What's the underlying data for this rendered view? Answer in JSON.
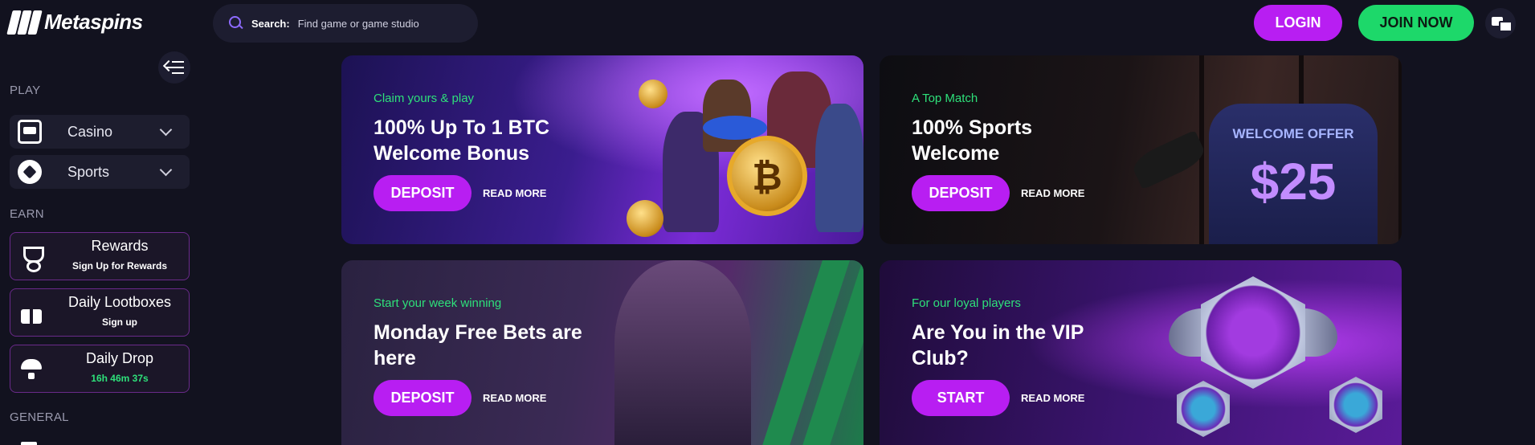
{
  "header": {
    "logo_text": "Metaspins",
    "search": {
      "label": "Search:",
      "placeholder": "Find game or game studio"
    },
    "login_label": "LOGIN",
    "join_label": "JOIN NOW"
  },
  "sidebar": {
    "play_title": "PLAY",
    "play_items": [
      {
        "label": "Casino",
        "icon": "slot-machine-icon"
      },
      {
        "label": "Sports",
        "icon": "soccer-ball-icon"
      }
    ],
    "earn_title": "EARN",
    "earn_items": [
      {
        "title": "Rewards",
        "subtitle": "Sign Up for Rewards",
        "icon": "trophy-icon"
      },
      {
        "title": "Daily Lootboxes",
        "subtitle": "Sign up",
        "icon": "gift-icon"
      },
      {
        "title": "Daily Drop",
        "subtitle": "16h 46m 37s",
        "icon": "parachute-icon"
      }
    ],
    "general_title": "GENERAL"
  },
  "promos": [
    {
      "tag": "Claim yours & play",
      "title": "100% Up To 1 BTC Welcome Bonus",
      "button": "DEPOSIT",
      "link": "READ MORE"
    },
    {
      "tag": "A Top Match",
      "title": "100% Sports Welcome",
      "button": "DEPOSIT",
      "link": "READ MORE",
      "art_text_1": "WELCOME OFFER",
      "art_text_2": "$25"
    },
    {
      "tag": "Start your week winning",
      "title": "Monday Free Bets are here",
      "button": "DEPOSIT",
      "link": "READ MORE"
    },
    {
      "tag": "For our loyal players",
      "title": "Are You in the VIP Club?",
      "button": "START",
      "link": "READ MORE"
    }
  ],
  "colors": {
    "background": "#12121f",
    "accent_purple": "#b81ef2",
    "accent_green": "#1dd86a",
    "tag_green": "#2ee07a"
  }
}
